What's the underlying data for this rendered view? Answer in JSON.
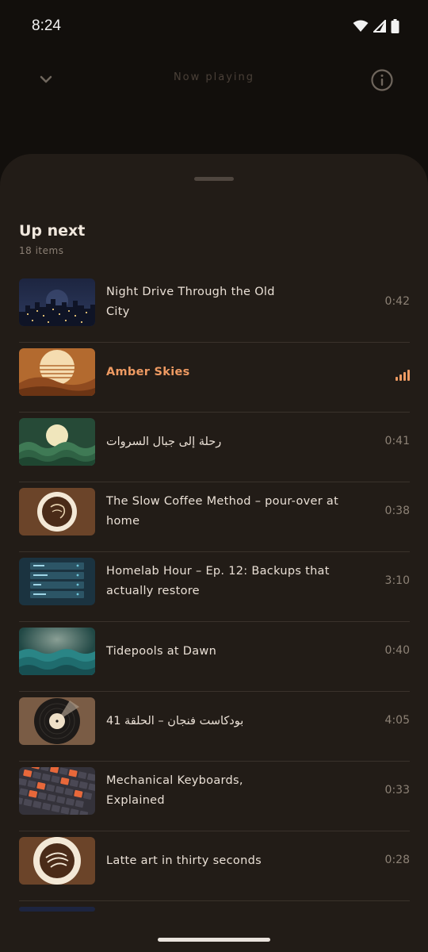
{
  "status_bar": {
    "time": "8:24"
  },
  "header": {
    "title": "Now playing"
  },
  "queue": {
    "title": "Up next",
    "count_label": "18 items",
    "items": [
      {
        "title": "Night Drive Through the Old City",
        "duration": "0:42",
        "thumb": "city-night-thumbnail"
      },
      {
        "title": "Amber Skies",
        "duration": "",
        "playing": true,
        "thumb": "desert-sunset-thumbnail"
      },
      {
        "title": "رحلة إلى جبال السروات",
        "duration": "0:41",
        "thumb": "green-hills-moon-thumbnail"
      },
      {
        "title": "The Slow Coffee Method – pour-over at home",
        "duration": "0:38",
        "thumb": "coffee-cup-thumbnail"
      },
      {
        "title": "Homelab Hour – Ep. 12: Backups that actually restore",
        "duration": "3:10",
        "thumb": "server-rack-thumbnail"
      },
      {
        "title": "Tidepools at Dawn",
        "duration": "0:40",
        "thumb": "sea-waves-thumbnail"
      },
      {
        "title": "بودكاست فنجان – الحلقة 41",
        "duration": "4:05",
        "thumb": "vinyl-record-thumbnail"
      },
      {
        "title": "Mechanical Keyboards, Explained",
        "duration": "0:33",
        "thumb": "keyboard-thumbnail"
      },
      {
        "title": "Latte art in thirty seconds",
        "duration": "0:28",
        "thumb": "latte-art-thumbnail"
      }
    ]
  },
  "colors": {
    "accent": "#ee9a62",
    "sheet": "#221c17",
    "background": "#120f0c"
  }
}
